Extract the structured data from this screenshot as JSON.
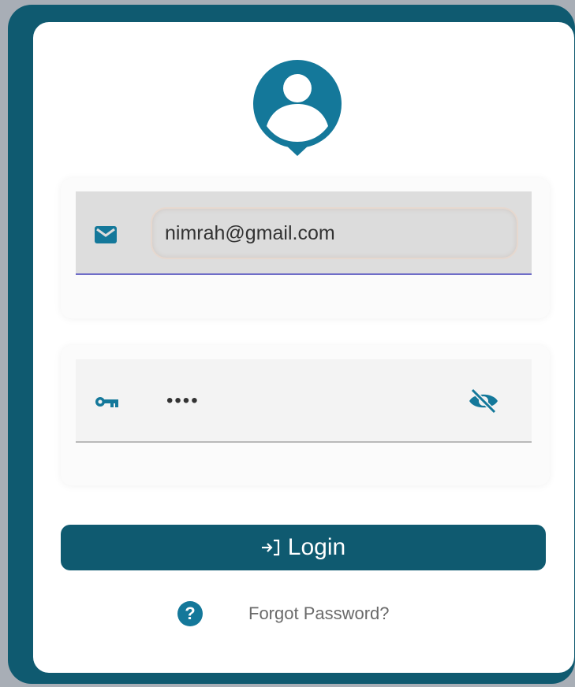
{
  "login_form": {
    "email_value": "nimrah@gmail.com",
    "password_value": "••••",
    "login_label": "Login",
    "forgot_label": "Forgot Password?",
    "help_glyph": "?"
  },
  "icons": {
    "avatar": "user-avatar-pin-icon",
    "email": "mail-icon",
    "password": "key-icon",
    "visibility": "eye-off-icon",
    "login": "login-arrow-icon",
    "help": "help-circle-icon"
  },
  "colors": {
    "frame": "#0f5a70",
    "accent": "#14789a",
    "button": "#0f5a70",
    "email_underline": "#6f6dc8"
  }
}
